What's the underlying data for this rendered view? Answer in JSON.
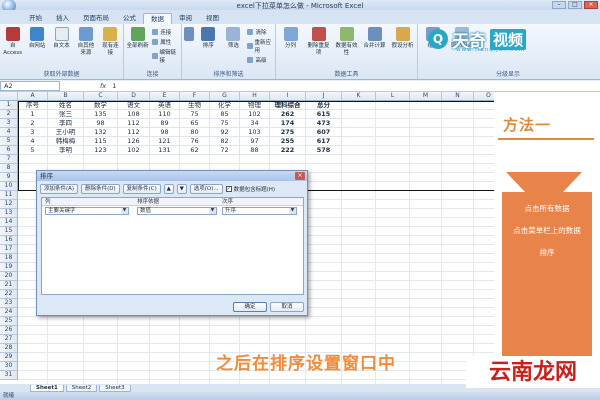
{
  "window": {
    "title": "excel下拉菜单怎么做 - Microsoft Excel"
  },
  "tabs": [
    "开始",
    "插入",
    "页面布局",
    "公式",
    "数据",
    "审阅",
    "视图"
  ],
  "active_tab": "数据",
  "ribbon": {
    "external": {
      "buttons": [
        "自 Access",
        "自网站",
        "自文本",
        "自其他来源",
        "现有连接"
      ],
      "label": "获取外部数据"
    },
    "connections": {
      "refresh": "全部刷新",
      "small": [
        "连接",
        "属性",
        "编辑链接"
      ],
      "label": "连接"
    },
    "sort": {
      "buttons": [
        "排序",
        "筛选"
      ],
      "small": [
        "清除",
        "重新应用",
        "高级"
      ],
      "label": "排序和筛选"
    },
    "tools": {
      "buttons": [
        "分列",
        "删除重复项",
        "数据有效性",
        "合并计算",
        "假设分析"
      ],
      "label": "数据工具"
    },
    "outline": {
      "buttons": [
        "组合",
        "取消组合"
      ],
      "label": "分级显示"
    }
  },
  "formula_bar": {
    "name_box": "A2",
    "fx": "fx",
    "value": "1"
  },
  "columns": [
    "A",
    "B",
    "C",
    "D",
    "E",
    "F",
    "G",
    "H",
    "I",
    "J",
    "K",
    "L",
    "M",
    "N",
    "O"
  ],
  "rows": [
    "1",
    "2",
    "3",
    "4",
    "5",
    "6",
    "7",
    "8",
    "9",
    "10",
    "11",
    "12",
    "13",
    "14",
    "15",
    "16",
    "17",
    "18",
    "19",
    "20",
    "21",
    "22",
    "23",
    "24",
    "25",
    "26",
    "27",
    "28",
    "29",
    "30",
    "31"
  ],
  "table": {
    "header": [
      "序号",
      "姓名",
      "数学",
      "语文",
      "英语",
      "生物",
      "化学",
      "物理",
      "理科综合",
      "总分"
    ],
    "rows": [
      [
        "1",
        "张三",
        "135",
        "108",
        "110",
        "75",
        "85",
        "102",
        "262",
        "615"
      ],
      [
        "2",
        "李四",
        "98",
        "112",
        "89",
        "65",
        "75",
        "34",
        "174",
        "473"
      ],
      [
        "3",
        "王小明",
        "132",
        "112",
        "98",
        "80",
        "92",
        "103",
        "275",
        "607"
      ],
      [
        "4",
        "韩梅梅",
        "115",
        "126",
        "121",
        "76",
        "82",
        "97",
        "255",
        "617"
      ],
      [
        "5",
        "李明",
        "123",
        "102",
        "131",
        "62",
        "72",
        "88",
        "222",
        "578"
      ]
    ]
  },
  "dialog": {
    "title": "排序",
    "close": "×",
    "add_level": "添加条件(A)",
    "delete_level": "删除条件(D)",
    "copy_level": "复制条件(C)",
    "up": "▲",
    "down": "▼",
    "options": "选项(O)...",
    "has_headers": "数据包含标题(H)",
    "has_headers_checked": "✓",
    "col_header": "列",
    "sorton_header": "排序依据",
    "order_header": "次序",
    "row_label": "主要关键字",
    "sort_on": "数值",
    "order": "升序",
    "ok": "确定",
    "cancel": "取消"
  },
  "sheet_tabs": [
    "Sheet1",
    "Sheet2",
    "Sheet3"
  ],
  "active_sheet": "Sheet1",
  "status": "就绪",
  "overlay": {
    "method": "方法一",
    "steps": [
      "点击所有数据",
      "点击菜单栏上的数据",
      "排序"
    ],
    "caption": "之后在排序设置窗口中",
    "logo_main": "天奇",
    "logo_tag": "视频",
    "logo_url": "www.tianqijun.com",
    "watermark": "云南龙网"
  },
  "colors": {
    "accent": "#e8844a",
    "caption": "#f08c3a",
    "logo": "#2aa7c8",
    "watermark": "#c8201a"
  }
}
